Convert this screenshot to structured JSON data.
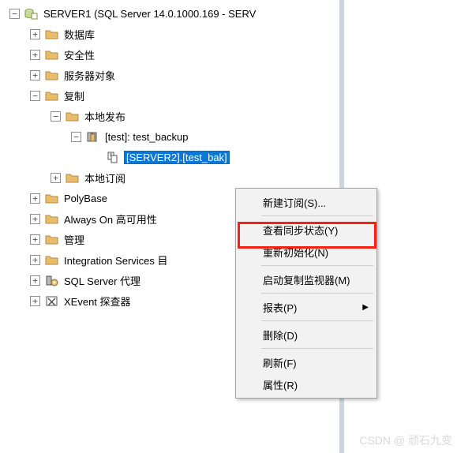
{
  "tree": {
    "server": "SERVER1 (SQL Server 14.0.1000.169 - SERV",
    "databases": "数据库",
    "security": "安全性",
    "server_objects": "服务器对象",
    "replication": "复制",
    "local_pub": "本地发布",
    "pub_item": "[test]: test_backup",
    "subscription": "[SERVER2].[test_bak]",
    "local_sub": "本地订阅",
    "polybase": "PolyBase",
    "alwayson": "Always On 高可用性",
    "management": "管理",
    "integration": "Integration Services 目",
    "agent": "SQL Server 代理",
    "xevent": "XEvent 探查器"
  },
  "menu": {
    "new_sub": "新建订阅(S)...",
    "view_sync": "查看同步状态(Y)",
    "reinit": "重新初始化(N)",
    "launch_monitor": "启动复制监视器(M)",
    "reports": "报表(P)",
    "delete": "删除(D)",
    "refresh": "刷新(F)",
    "properties": "属性(R)"
  },
  "watermark": "CSDN @ 顽石九变"
}
